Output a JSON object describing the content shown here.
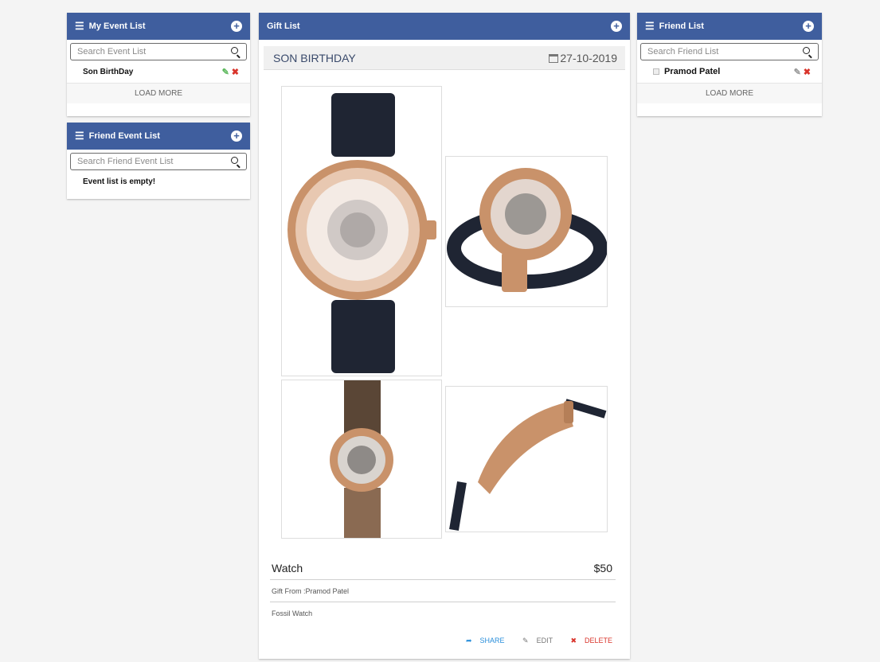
{
  "my_events": {
    "title": "My Event List",
    "search_placeholder": "Search Event List",
    "items": [
      {
        "name": "Son BirthDay"
      }
    ],
    "load_more": "LOAD MORE"
  },
  "friend_events": {
    "title": "Friend Event List",
    "search_placeholder": "Search Friend Event List",
    "empty_text": "Event list is empty!"
  },
  "gift_list": {
    "title": "Gift List",
    "event_name": "SON BIRTHDAY",
    "event_date": "27-10-2019",
    "gift": {
      "name": "Watch",
      "price": "$50",
      "from": "Gift From :Pramod Patel",
      "description": "Fossil Watch"
    },
    "actions": {
      "share": "SHARE",
      "edit": "EDIT",
      "delete": "DELETE"
    }
  },
  "friend_list": {
    "title": "Friend List",
    "search_placeholder": "Search Friend List",
    "items": [
      {
        "name": "Pramod Patel"
      }
    ],
    "load_more": "LOAD MORE"
  },
  "colors": {
    "header": "#3f5e9e",
    "share": "#2a8fdb",
    "delete": "#d9342b",
    "edit_icon": "#5cb85c"
  },
  "icons": [
    "menu-icon",
    "add-circle-icon",
    "search-icon",
    "edit-icon",
    "delete-icon",
    "calendar-icon",
    "share-icon",
    "checkbox-icon"
  ]
}
